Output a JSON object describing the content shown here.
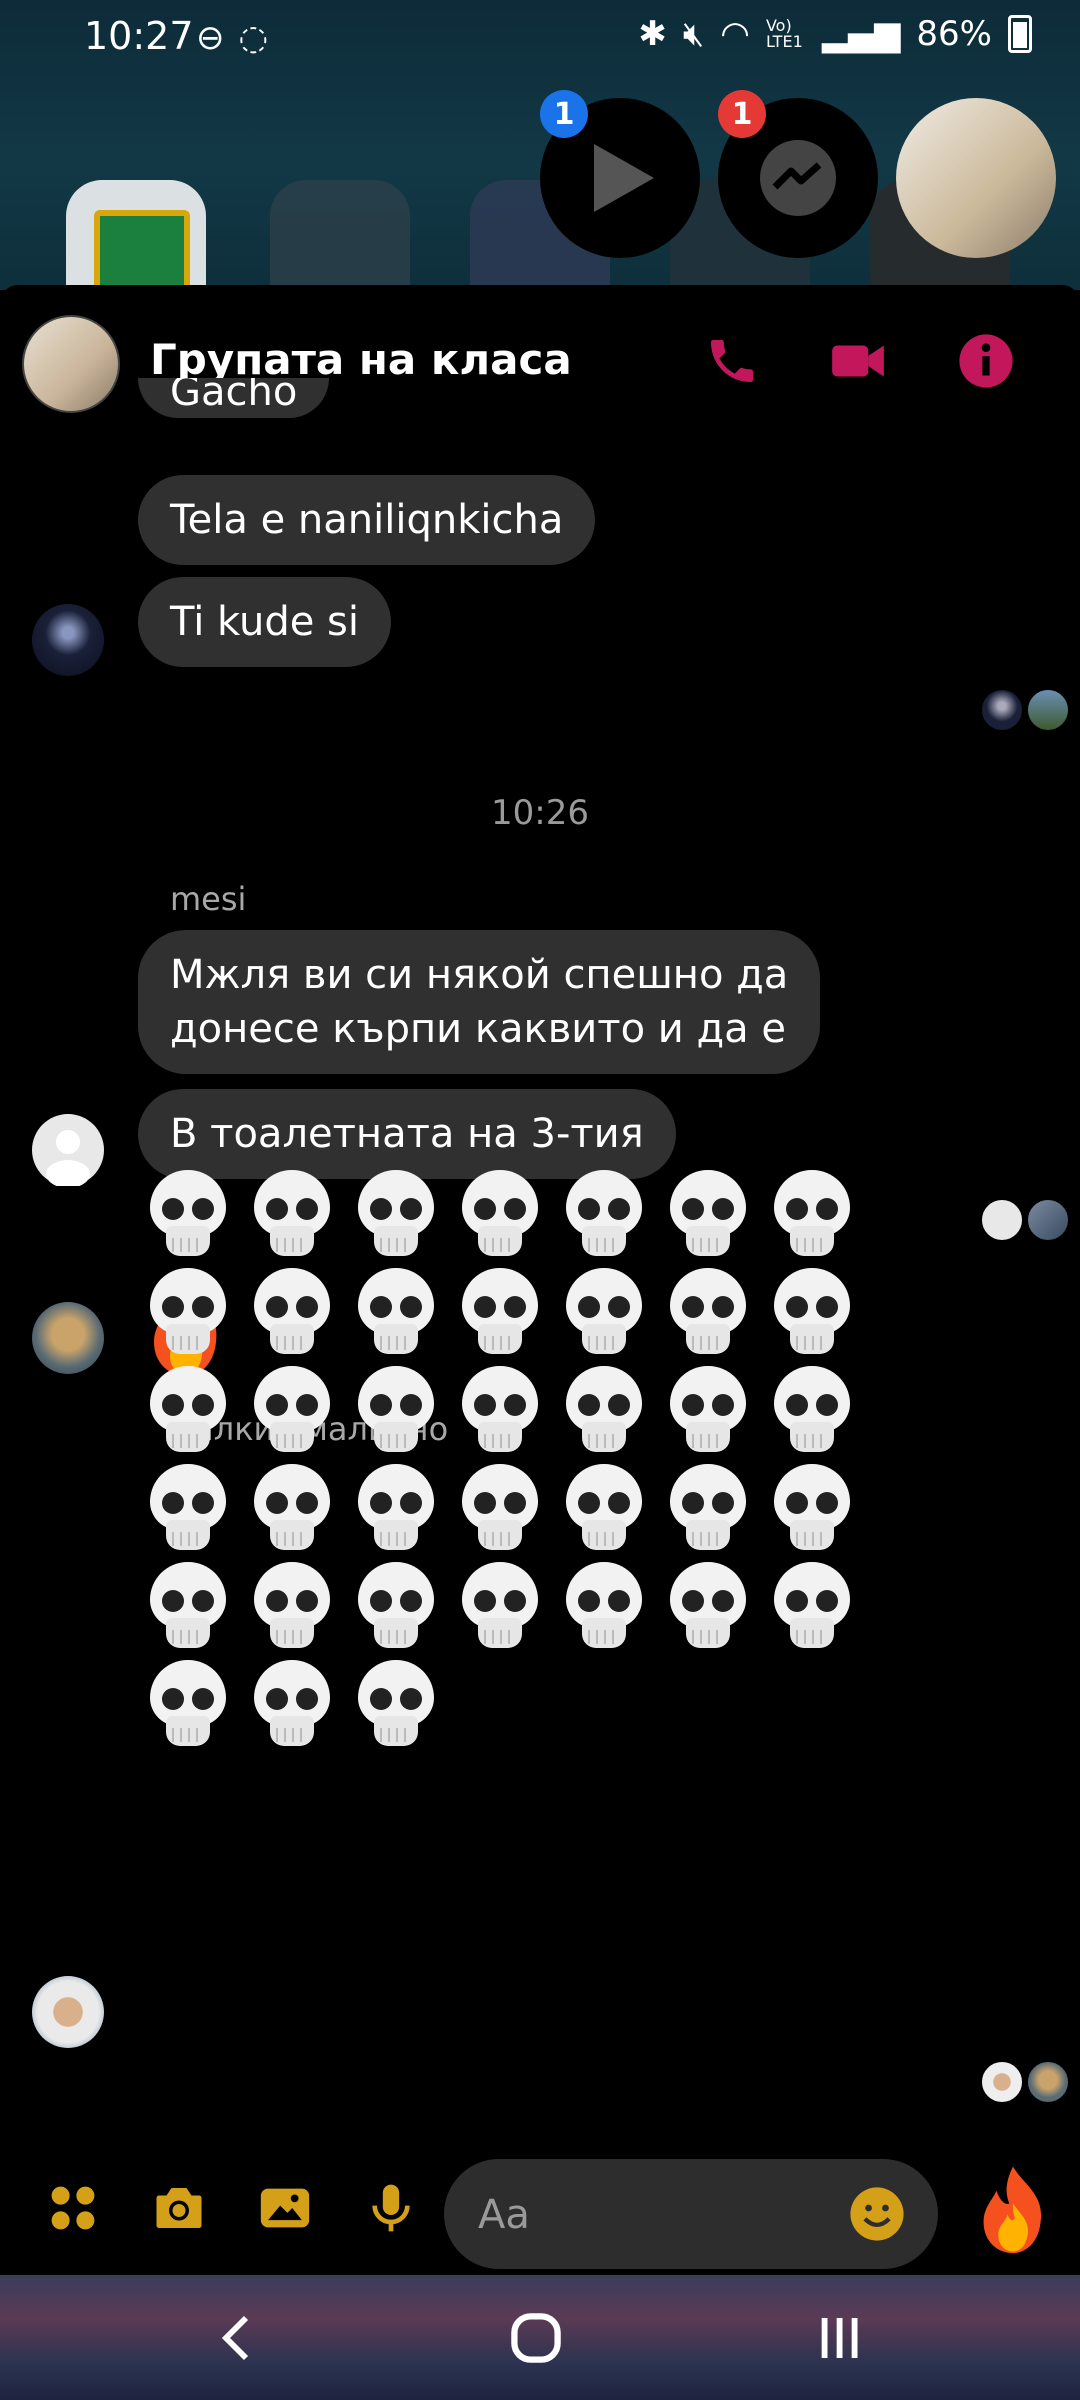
{
  "status_bar": {
    "time": "10:27",
    "battery": "86%",
    "network_label": "Vo) LTE1"
  },
  "bubbles": [
    {
      "badge": "1",
      "icon": "play-icon",
      "badge_color": "#1a73e8"
    },
    {
      "badge": "1",
      "icon": "messenger-icon",
      "badge_color": "#e53935"
    }
  ],
  "chat_header": {
    "title": "Групата на класа",
    "accent_color": "#c2185b"
  },
  "messages": {
    "partial_top": "Gacho",
    "msg1": "Tela e naniliqnkicha",
    "msg2": "Ti kude si",
    "timestamp": "10:26",
    "sender_mesi": "mesi",
    "msg3_line1": "Мжля ви си някой спешно да",
    "msg3_line2": "донесе кърпи каквито и да е",
    "msg4": "В тоалетната на 3-тия",
    "sender_malinco": "малкия малинчо",
    "skull_count": 38
  },
  "composer": {
    "placeholder": "Aa",
    "icon_color": "#d4a017"
  },
  "navbar": {
    "back": "back-icon",
    "home": "home-icon",
    "recents": "recents-icon"
  }
}
